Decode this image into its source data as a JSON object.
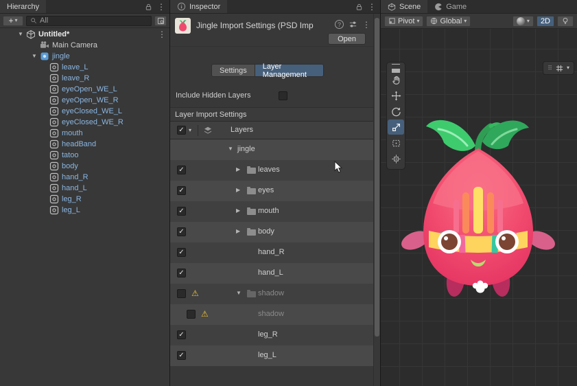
{
  "colors": {
    "selection": "#46607c",
    "warning": "#f2c230",
    "scene-bg": "#2c2c2c"
  },
  "hierarchy": {
    "tab": "Hierarchy",
    "search_scope": "All",
    "items": [
      {
        "label": "Untitled*",
        "cls": "d0",
        "open": true,
        "scene": true,
        "kebab": true,
        "bold": true
      },
      {
        "label": "Main Camera",
        "cls": "d1",
        "camera": true
      },
      {
        "label": "jingle",
        "cls": "d1",
        "open": true,
        "prefab": true,
        "blue": true
      },
      {
        "label": "leave_L",
        "cls": "d2",
        "sprite": true,
        "blue": true
      },
      {
        "label": "leave_R",
        "cls": "d2",
        "sprite": true,
        "blue": true
      },
      {
        "label": "eyeOpen_WE_L",
        "cls": "d2",
        "sprite": true,
        "blue": true
      },
      {
        "label": "eyeOpen_WE_R",
        "cls": "d2",
        "sprite": true,
        "blue": true
      },
      {
        "label": "eyeClosed_WE_L",
        "cls": "d2",
        "sprite": true,
        "blue": true
      },
      {
        "label": "eyeClosed_WE_R",
        "cls": "d2",
        "sprite": true,
        "blue": true
      },
      {
        "label": "mouth",
        "cls": "d2",
        "sprite": true,
        "blue": true
      },
      {
        "label": "headBand",
        "cls": "d2",
        "sprite": true,
        "blue": true
      },
      {
        "label": "tatoo",
        "cls": "d2",
        "sprite": true,
        "blue": true
      },
      {
        "label": "body",
        "cls": "d2",
        "sprite": true,
        "blue": true
      },
      {
        "label": "hand_R",
        "cls": "d2",
        "sprite": true,
        "blue": true
      },
      {
        "label": "hand_L",
        "cls": "d2",
        "sprite": true,
        "blue": true
      },
      {
        "label": "leg_R",
        "cls": "d2",
        "sprite": true,
        "blue": true
      },
      {
        "label": "leg_L",
        "cls": "d2",
        "sprite": true,
        "blue": true
      }
    ]
  },
  "inspector": {
    "tab": "Inspector",
    "title": "Jingle Import Settings (PSD Imp",
    "open_button": "Open",
    "tab_settings": "Settings",
    "tab_layer_management": "Layer Management",
    "include_hidden_layers_label": "Include Hidden Layers",
    "section_title": "Layer Import Settings",
    "layers_column": "Layers",
    "rows": [
      {
        "label": "jingle",
        "root": true,
        "open": true
      },
      {
        "label": "leaves",
        "chk": true,
        "checked": true,
        "closed": true,
        "folder": true
      },
      {
        "label": "eyes",
        "chk": true,
        "checked": true,
        "closed": true,
        "folder": true
      },
      {
        "label": "mouth",
        "chk": true,
        "checked": true,
        "closed": true,
        "folder": true
      },
      {
        "label": "body",
        "chk": true,
        "checked": true,
        "closed": true,
        "folder": true
      },
      {
        "label": "hand_R",
        "chk": true,
        "checked": true
      },
      {
        "label": "hand_L",
        "chk": true,
        "checked": true
      },
      {
        "label": "shadow",
        "chk": true,
        "warning": true,
        "open": true,
        "folder": true,
        "dim": true
      },
      {
        "label": "shadow",
        "chk": true,
        "warning": true,
        "dim": true,
        "child": true
      },
      {
        "label": "leg_R",
        "chk": true,
        "checked": true
      },
      {
        "label": "leg_L",
        "chk": true,
        "checked": true
      }
    ]
  },
  "scene": {
    "tab_scene": "Scene",
    "tab_game": "Game",
    "pivot_label": "Pivot",
    "global_label": "Global",
    "two_d_label": "2D"
  }
}
